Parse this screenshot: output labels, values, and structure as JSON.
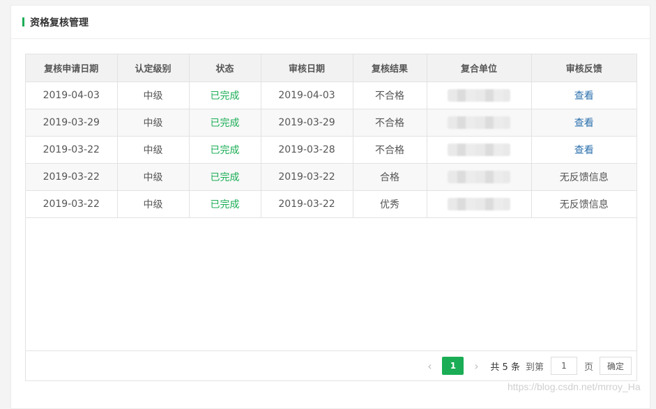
{
  "panel": {
    "title": "资格复核管理"
  },
  "table": {
    "headers": [
      "复核申请日期",
      "认定级别",
      "状态",
      "审核日期",
      "复核结果",
      "复合单位",
      "审核反馈"
    ],
    "rows": [
      {
        "apply_date": "2019-04-03",
        "level": "中级",
        "status": "已完成",
        "review_date": "2019-04-03",
        "result": "不合格",
        "feedback": "查看"
      },
      {
        "apply_date": "2019-03-29",
        "level": "中级",
        "status": "已完成",
        "review_date": "2019-03-29",
        "result": "不合格",
        "feedback": "查看"
      },
      {
        "apply_date": "2019-03-22",
        "level": "中级",
        "status": "已完成",
        "review_date": "2019-03-28",
        "result": "不合格",
        "feedback": "查看"
      },
      {
        "apply_date": "2019-03-22",
        "level": "中级",
        "status": "已完成",
        "review_date": "2019-03-22",
        "result": "合格",
        "feedback": "无反馈信息"
      },
      {
        "apply_date": "2019-03-22",
        "level": "中级",
        "status": "已完成",
        "review_date": "2019-03-22",
        "result": "优秀",
        "feedback": "无反馈信息"
      }
    ]
  },
  "pagination": {
    "prev_icon": "‹",
    "current_page": "1",
    "next_icon": "›",
    "total_text": "共 5 条",
    "goto_label": "到第",
    "goto_value": "1",
    "page_label": "页",
    "confirm_label": "确定"
  },
  "watermark": "https://blog.csdn.net/mrroy_Ha",
  "colors": {
    "accent": "#1aad55",
    "link": "#2a6fad"
  }
}
